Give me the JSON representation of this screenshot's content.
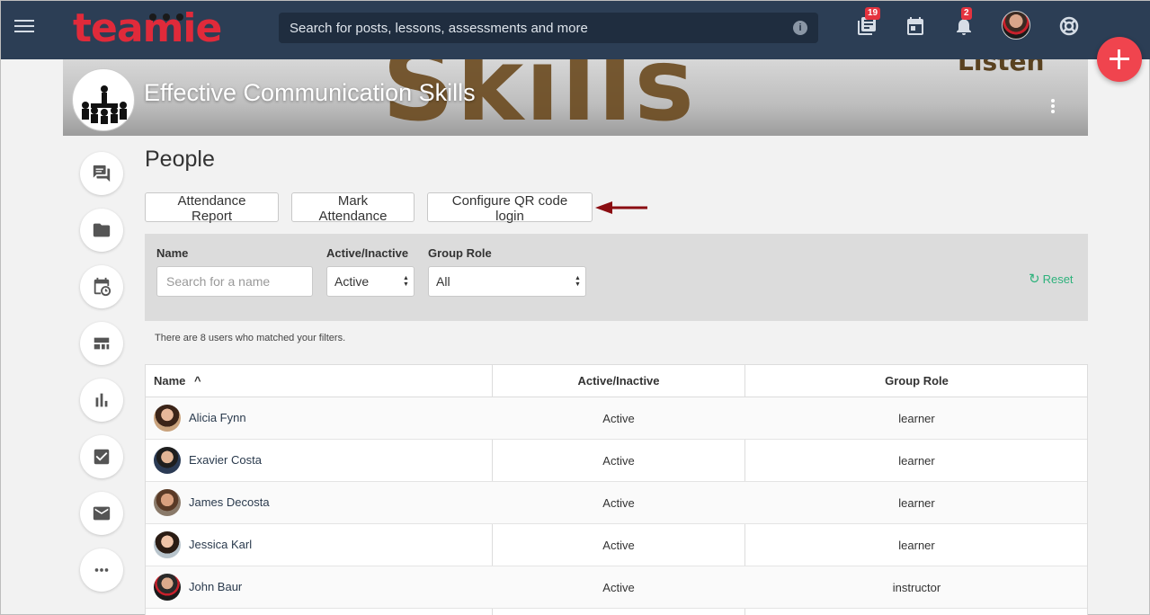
{
  "app": {
    "logo_text": "teamie",
    "search_placeholder": "Search for posts, lessons, assessments and more",
    "info_label": "i"
  },
  "nav": {
    "library_badge": "19",
    "notifications_badge": "2"
  },
  "course": {
    "title": "Effective Communication Skills",
    "banner_word": "Skills",
    "banner_word2": "Listen"
  },
  "page": {
    "title": "People",
    "buttons": {
      "attendance_report": "Attendance Report",
      "mark_attendance": "Mark Attendance",
      "configure_qr": "Configure QR code login"
    }
  },
  "filters": {
    "name_label": "Name",
    "name_placeholder": "Search for a name",
    "status_label": "Active/Inactive",
    "status_value": "Active",
    "role_label": "Group Role",
    "role_value": "All",
    "reset_label": "Reset",
    "match_text": "There are 8 users who matched your filters."
  },
  "table": {
    "headers": {
      "name": "Name",
      "sort_indicator": "^",
      "status": "Active/Inactive",
      "role": "Group Role"
    },
    "rows": [
      {
        "name": "Alicia Fynn",
        "status": "Active",
        "role": "learner"
      },
      {
        "name": "Exavier Costa",
        "status": "Active",
        "role": "learner"
      },
      {
        "name": "James Decosta",
        "status": "Active",
        "role": "learner"
      },
      {
        "name": "Jessica Karl",
        "status": "Active",
        "role": "learner"
      },
      {
        "name": "John Baur",
        "status": "Active",
        "role": "instructor"
      }
    ]
  },
  "colors": {
    "topbar": "#2c3e55",
    "brand_red": "#e02a3a",
    "accent_green": "#2eb27c",
    "fab": "#f0444e",
    "annotation_arrow": "#8b0d12"
  }
}
